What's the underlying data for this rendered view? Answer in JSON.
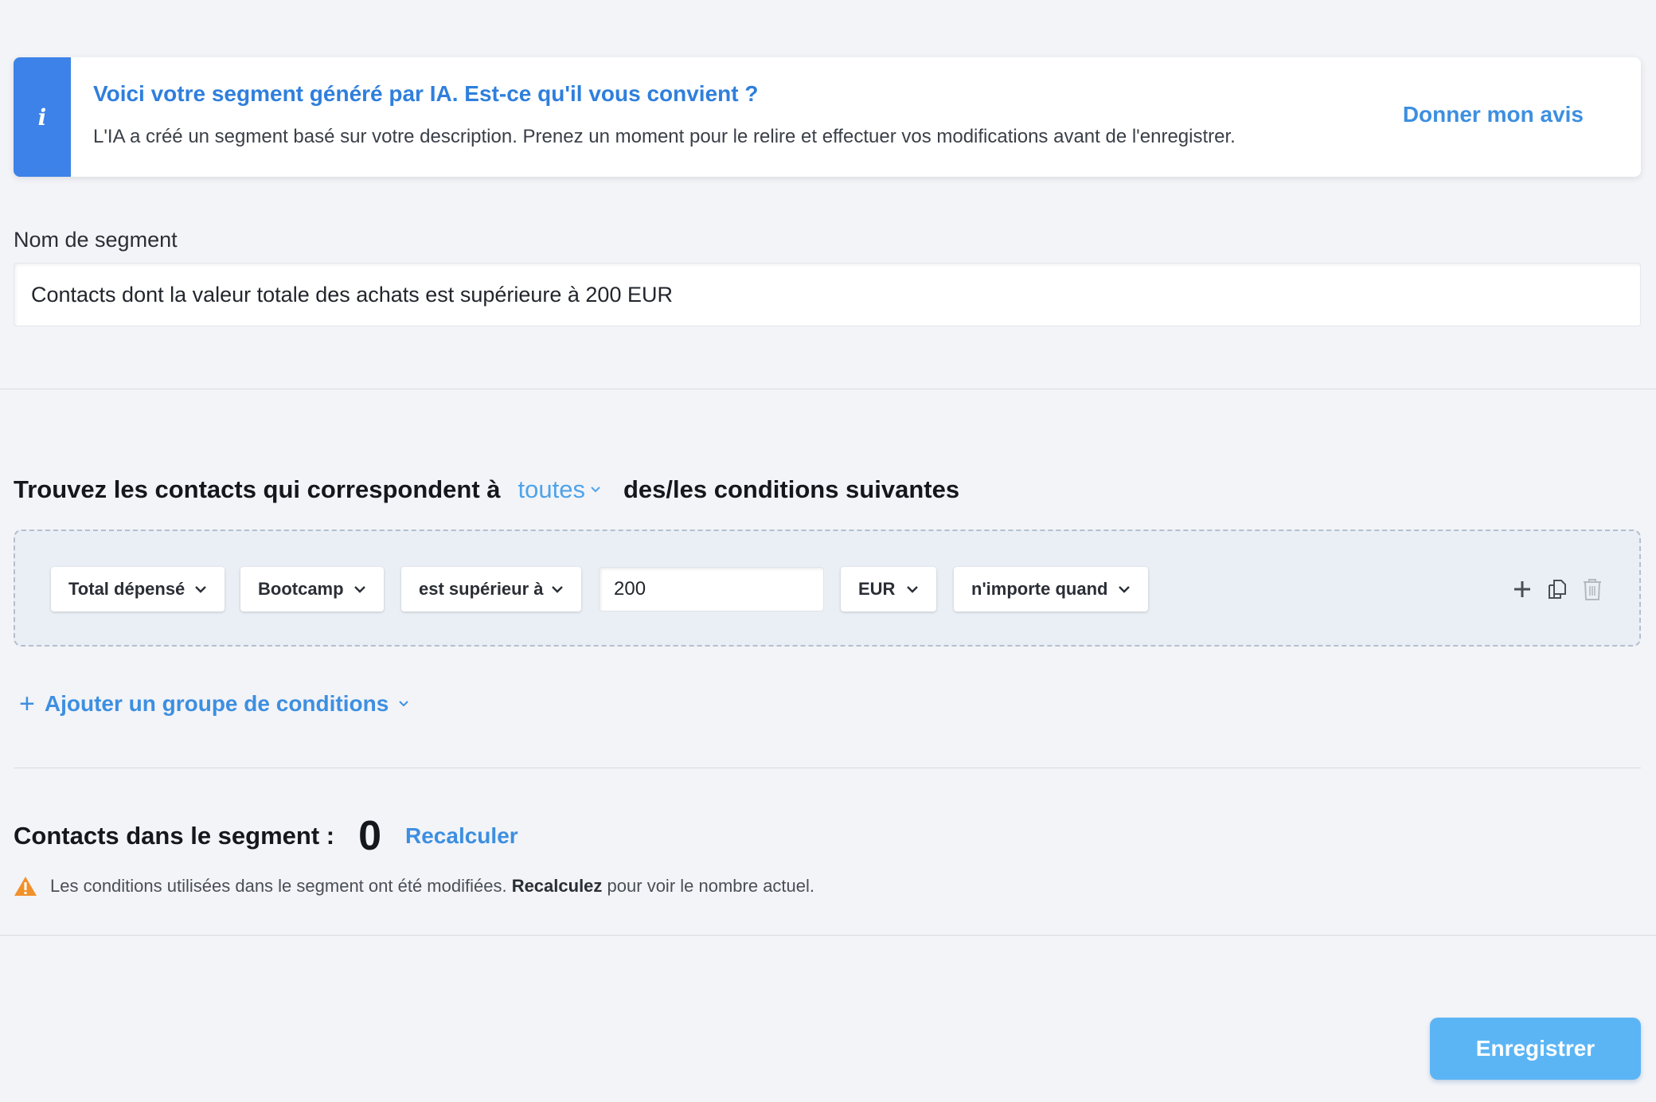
{
  "banner": {
    "icon": "info-icon",
    "icon_glyph": "i",
    "title": "Voici votre segment généré par IA. Est-ce qu'il vous convient ?",
    "description": "L'IA a créé un segment basé sur votre description. Prenez un moment pour le relire et effectuer vos modifications avant de l'enregistrer.",
    "feedback_link": "Donner mon avis"
  },
  "segment_name": {
    "label": "Nom de segment",
    "value": "Contacts dont la valeur totale des achats est supérieure à 200 EUR"
  },
  "conditions": {
    "heading_prefix": "Trouvez les contacts qui correspondent à",
    "match_mode": "toutes",
    "heading_suffix": "des/les conditions suivantes",
    "row": {
      "attribute": "Total dépensé",
      "source": "Bootcamp",
      "operator": "est supérieur à",
      "value": "200",
      "currency": "EUR",
      "timeframe": "n'importe quand"
    },
    "row_actions": [
      "plus-icon",
      "copy-icon",
      "trash-icon"
    ],
    "add_group_label": "Ajouter un groupe de conditions"
  },
  "count": {
    "label": "Contacts dans le segment :",
    "value": "0",
    "recalculate_link": "Recalculer",
    "warning_prefix": "Les conditions utilisées dans le segment ont été modifiées.",
    "warning_bold": "Recalculez",
    "warning_suffix": "pour voir le nombre actuel."
  },
  "save_button": "Enregistrer",
  "colors": {
    "accent": "#3c82e8",
    "link": "#3d8fe0",
    "save_button": "#5bb5f5",
    "warning": "#f0912b",
    "background": "#f3f4f8"
  }
}
